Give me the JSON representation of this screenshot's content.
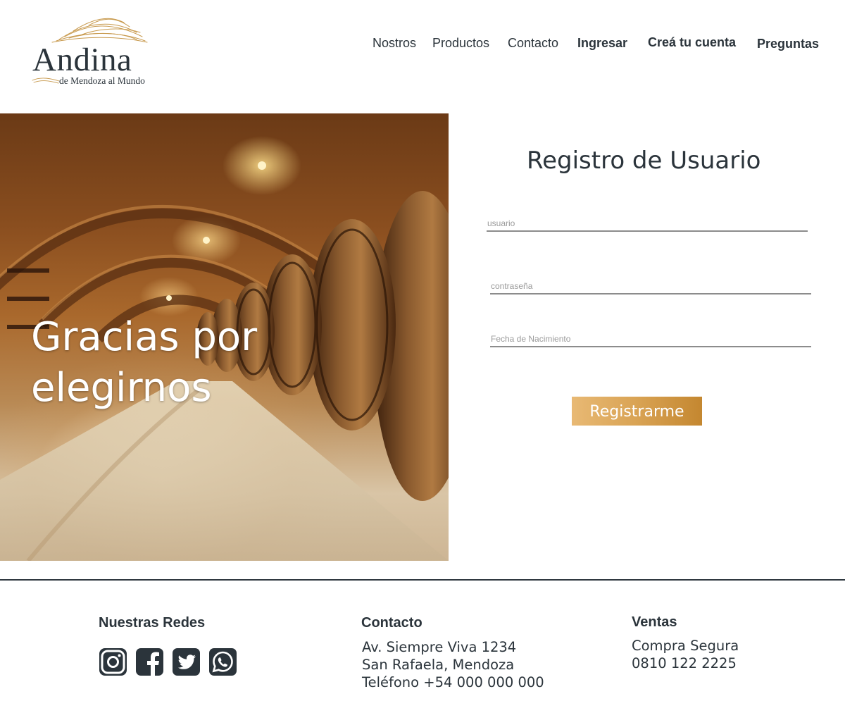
{
  "brand": {
    "name": "Andina",
    "tagline": "de Mendoza al Mundo"
  },
  "nav": {
    "items": [
      {
        "label": "Nostros"
      },
      {
        "label": "Productos"
      },
      {
        "label": "Contacto"
      },
      {
        "label": "Ingresar"
      },
      {
        "label": "Creá tu cuenta"
      },
      {
        "label": "Preguntas"
      }
    ]
  },
  "hero": {
    "title": "Gracias por elegirnos"
  },
  "form": {
    "title": "Registro de Usuario",
    "username_placeholder": "usuario",
    "password_placeholder": "contraseña",
    "birthdate_placeholder": "Fecha de Nacimiento",
    "submit_label": "Registrarme"
  },
  "footer": {
    "social": {
      "title": "Nuestras Redes",
      "icons": [
        "instagram-icon",
        "facebook-icon",
        "twitter-icon",
        "whatsapp-icon"
      ]
    },
    "contact": {
      "title": "Contacto",
      "address": "Av. Siempre Viva 1234",
      "city": "San Rafaela, Mendoza",
      "phone": "Teléfono +54 000 000 000"
    },
    "sales": {
      "title": "Ventas",
      "line1": "Compra Segura",
      "phone": "0810 122 2225"
    }
  },
  "colors": {
    "text": "#2b343b",
    "accent_gold": "#d9a354",
    "footer_rule": "#2f3840"
  }
}
